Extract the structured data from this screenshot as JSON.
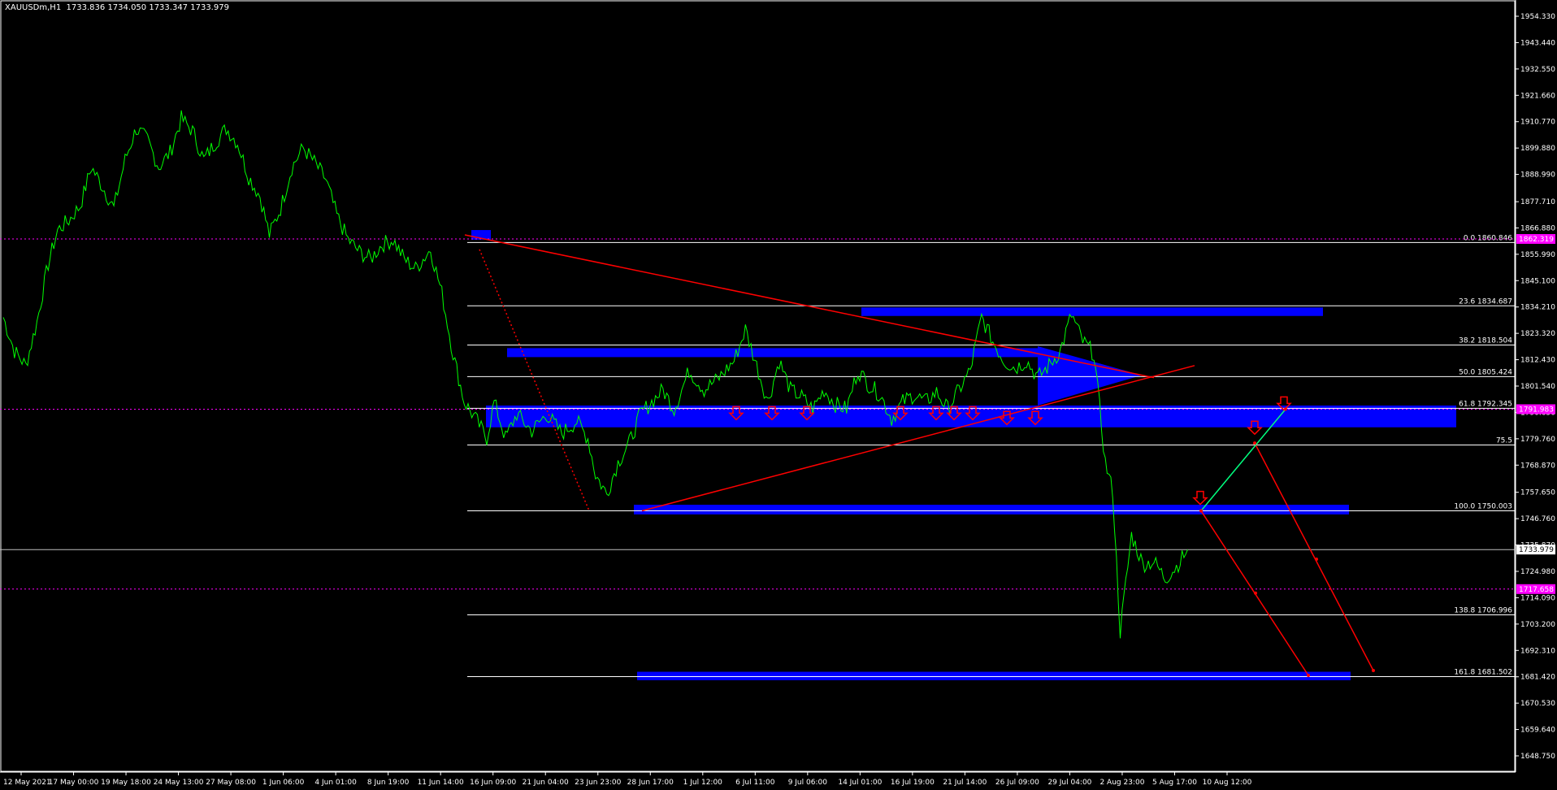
{
  "header": {
    "symbol": "XAUUSDm,H1",
    "ohlc": "1733.836 1734.050 1733.347 1733.979"
  },
  "colors": {
    "background": "#000000",
    "price_line": "#00ff00",
    "zone": "#0000ff",
    "trend": "#ff0000",
    "projection": "#00ff7f",
    "fib": "#ffffff",
    "marker": "#ff00ff"
  },
  "chart_data": {
    "type": "line",
    "symbol": "XAUUSDm",
    "timeframe": "H1",
    "y_ticks": [
      "1954.330",
      "1943.440",
      "1932.550",
      "1921.660",
      "1910.770",
      "1899.880",
      "1888.990",
      "1877.710",
      "1866.880",
      "1855.990",
      "1845.100",
      "1834.210",
      "1823.320",
      "1812.430",
      "1801.540",
      "1790.650",
      "1779.760",
      "1768.870",
      "1757.650",
      "1746.760",
      "1735.870",
      "1724.980",
      "1714.090",
      "1703.200",
      "1692.310",
      "1681.420",
      "1670.530",
      "1659.640",
      "1648.750"
    ],
    "ylim": [
      1648.75,
      1954.33
    ],
    "x_ticks": [
      "12 May 2021",
      "17 May 00:00",
      "19 May 18:00",
      "24 May 13:00",
      "27 May 08:00",
      "1 Jun 06:00",
      "4 Jun 01:00",
      "8 Jun 19:00",
      "11 Jun 14:00",
      "16 Jun 09:00",
      "21 Jun 04:00",
      "23 Jun 23:00",
      "28 Jun 17:00",
      "1 Jul 12:00",
      "6 Jul 11:00",
      "9 Jul 06:00",
      "14 Jul 01:00",
      "16 Jul 19:00",
      "21 Jul 14:00",
      "26 Jul 09:00",
      "29 Jul 04:00",
      "2 Aug 23:00",
      "5 Aug 17:00",
      "10 Aug 12:00"
    ],
    "current_price": "1733.979",
    "price_markers": [
      "1862.319",
      "1791.983",
      "1717.658"
    ],
    "fib_levels": [
      {
        "label": "0.0 1860.846",
        "value": 1860.846
      },
      {
        "label": "23.6 1834.687",
        "value": 1834.687
      },
      {
        "label": "38.2 1818.504",
        "value": 1818.504
      },
      {
        "label": "50.0 1805.424",
        "value": 1805.424
      },
      {
        "label": "61.8 1792.345",
        "value": 1792.345
      },
      {
        "label": "75.5",
        "value": 1777.2
      },
      {
        "label": "100.0 1750.003",
        "value": 1750.003
      },
      {
        "label": "138.8 1706.996",
        "value": 1706.996
      },
      {
        "label": "161.8 1681.502",
        "value": 1681.502
      }
    ],
    "series": [
      {
        "values": [
          [
            0,
            1830
          ],
          [
            6,
            1816
          ],
          [
            12,
            1810
          ],
          [
            18,
            1828
          ],
          [
            24,
            1852
          ],
          [
            29,
            1866
          ],
          [
            35,
            1870
          ],
          [
            41,
            1876
          ],
          [
            47,
            1892
          ],
          [
            53,
            1884
          ],
          [
            59,
            1875
          ],
          [
            65,
            1895
          ],
          [
            71,
            1908
          ],
          [
            77,
            1903
          ],
          [
            83,
            1892
          ],
          [
            89,
            1898
          ],
          [
            95,
            1912
          ],
          [
            101,
            1907
          ],
          [
            107,
            1895
          ],
          [
            113,
            1902
          ],
          [
            119,
            1908
          ],
          [
            125,
            1902
          ],
          [
            131,
            1888
          ],
          [
            137,
            1880
          ],
          [
            142,
            1864
          ],
          [
            148,
            1875
          ],
          [
            154,
            1892
          ],
          [
            160,
            1900
          ],
          [
            166,
            1894
          ],
          [
            172,
            1887
          ],
          [
            178,
            1872
          ],
          [
            184,
            1862
          ],
          [
            190,
            1857
          ],
          [
            196,
            1854
          ],
          [
            202,
            1860
          ],
          [
            208,
            1862
          ],
          [
            214,
            1854
          ],
          [
            220,
            1850
          ],
          [
            228,
            1858
          ],
          [
            234,
            1840
          ],
          [
            240,
            1815
          ],
          [
            246,
            1795
          ],
          [
            252,
            1788
          ],
          [
            258,
            1780
          ],
          [
            262,
            1795
          ],
          [
            268,
            1780
          ],
          [
            274,
            1790
          ],
          [
            282,
            1783
          ],
          [
            290,
            1790
          ],
          [
            298,
            1782
          ],
          [
            306,
            1787
          ],
          [
            312,
            1780
          ],
          [
            316,
            1765
          ],
          [
            322,
            1757
          ],
          [
            328,
            1770
          ],
          [
            334,
            1778
          ],
          [
            340,
            1790
          ],
          [
            346,
            1795
          ],
          [
            352,
            1800
          ],
          [
            358,
            1792
          ],
          [
            366,
            1808
          ],
          [
            374,
            1800
          ],
          [
            382,
            1805
          ],
          [
            390,
            1812
          ],
          [
            396,
            1825
          ],
          [
            402,
            1810
          ],
          [
            408,
            1795
          ],
          [
            414,
            1812
          ],
          [
            420,
            1800
          ],
          [
            426,
            1797
          ],
          [
            432,
            1792
          ],
          [
            438,
            1800
          ],
          [
            444,
            1794
          ],
          [
            450,
            1792
          ],
          [
            456,
            1808
          ],
          [
            462,
            1802
          ],
          [
            468,
            1798
          ],
          [
            474,
            1788
          ],
          [
            480,
            1795
          ],
          [
            486,
            1798
          ],
          [
            492,
            1795
          ],
          [
            498,
            1799
          ],
          [
            504,
            1792
          ],
          [
            510,
            1800
          ],
          [
            516,
            1808
          ],
          [
            522,
            1830
          ],
          [
            528,
            1820
          ],
          [
            534,
            1812
          ],
          [
            540,
            1809
          ],
          [
            546,
            1812
          ],
          [
            552,
            1805
          ],
          [
            558,
            1810
          ],
          [
            564,
            1816
          ],
          [
            570,
            1831
          ],
          [
            576,
            1820
          ],
          [
            582,
            1815
          ],
          [
            588,
            1770
          ],
          [
            592,
            1758
          ],
          [
            596,
            1700
          ],
          [
            602,
            1740
          ],
          [
            608,
            1728
          ],
          [
            614,
            1729
          ],
          [
            620,
            1722
          ],
          [
            626,
            1727
          ],
          [
            632,
            1733.979
          ]
        ]
      }
    ]
  }
}
